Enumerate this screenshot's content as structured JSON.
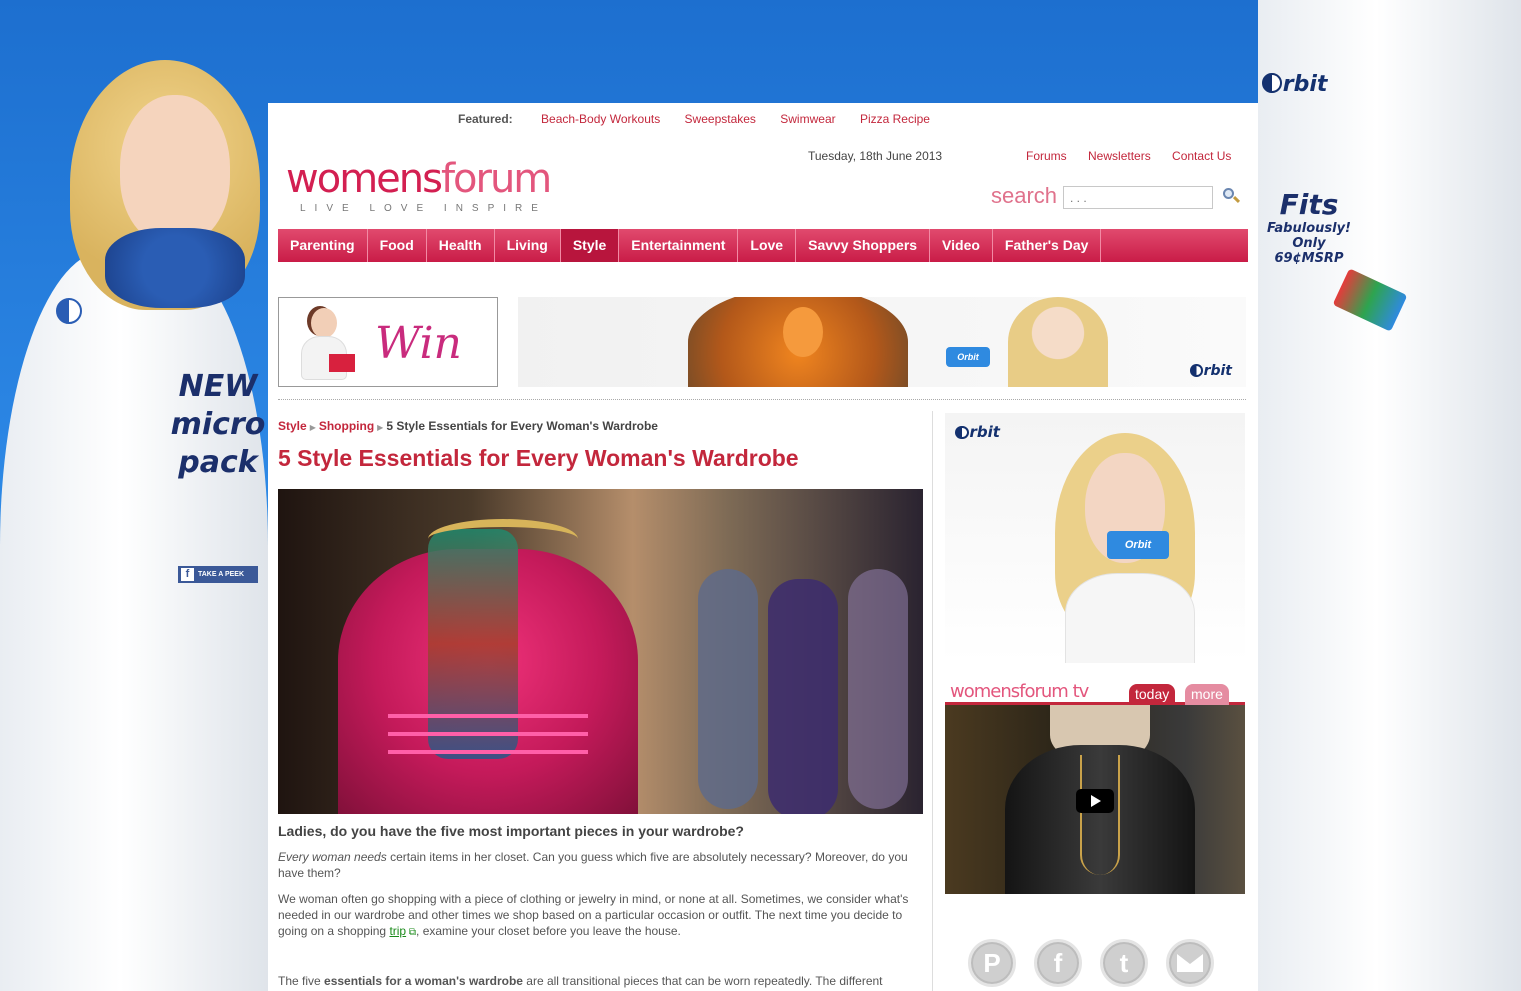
{
  "left_ad": {
    "headline_lines": [
      "NEW",
      "micro",
      "pack"
    ],
    "take_peek": "TAKE A PEEK",
    "facebook_glyph": "f"
  },
  "right_ad": {
    "brand": "rbit",
    "fits_title": "Fits",
    "fits_sub": "Fabulously!",
    "price": "Only 69¢MSRP"
  },
  "header": {
    "featured_label": "Featured:",
    "featured_links": [
      "Beach-Body Workouts",
      "Sweepstakes",
      "Swimwear",
      "Pizza Recipe"
    ],
    "logo_part1": "womens",
    "logo_part2": "forum",
    "logo_tagline": "LIVE LOVE INSPIRE",
    "date": "Tuesday, 18th June 2013",
    "top_links": [
      "Forums",
      "Newsletters",
      "Contact Us"
    ],
    "search_label": "search",
    "search_placeholder": ". . ."
  },
  "nav": {
    "items": [
      "Parenting",
      "Food",
      "Health",
      "Living",
      "Style",
      "Entertainment",
      "Love",
      "Savvy Shoppers",
      "Video",
      "Father's Day"
    ],
    "active": "Style"
  },
  "promo": {
    "win_text": "Win",
    "banner_brand": "rbit",
    "banner_pack": "Orbit"
  },
  "article": {
    "breadcrumb": [
      "Style",
      "Shopping",
      "5 Style Essentials for Every Woman's Wardrobe"
    ],
    "title": "5 Style Essentials for Every Woman's Wardrobe",
    "subhead": "Ladies, do you have the five most important pieces in your wardrobe?",
    "p1_em": "Every woman needs",
    "p1_rest": " certain items in her closet. Can you guess which five are absolutely necessary? Moreover, do you have them?",
    "p2_before": "We woman often go shopping with a piece of clothing or jewelry in mind, or none at all. Sometimes, we consider what's needed in our wardrobe and other times we shop based on a particular occasion or outfit. The next time you decide to going on a shopping ",
    "p2_link": "trip",
    "p2_after": ", examine your closet before you leave the house.",
    "p3_before": "The five ",
    "p3_strong": "essentials for a woman's wardrobe",
    "p3_after": " are all transitional pieces that can be worn repeatedly. The different"
  },
  "sidebar": {
    "ad_brand": "rbit",
    "ad_pack": "Orbit",
    "tv_title_part1": "womensforum",
    "tv_title_part2": "tv",
    "tv_tabs": [
      "today",
      "more"
    ],
    "social_glyphs": [
      "P",
      "f",
      "t"
    ]
  },
  "colors": {
    "brand": "#c3273c",
    "nav_gradient_top": "#e14a6e",
    "background_blue": "#1d6fcf"
  }
}
